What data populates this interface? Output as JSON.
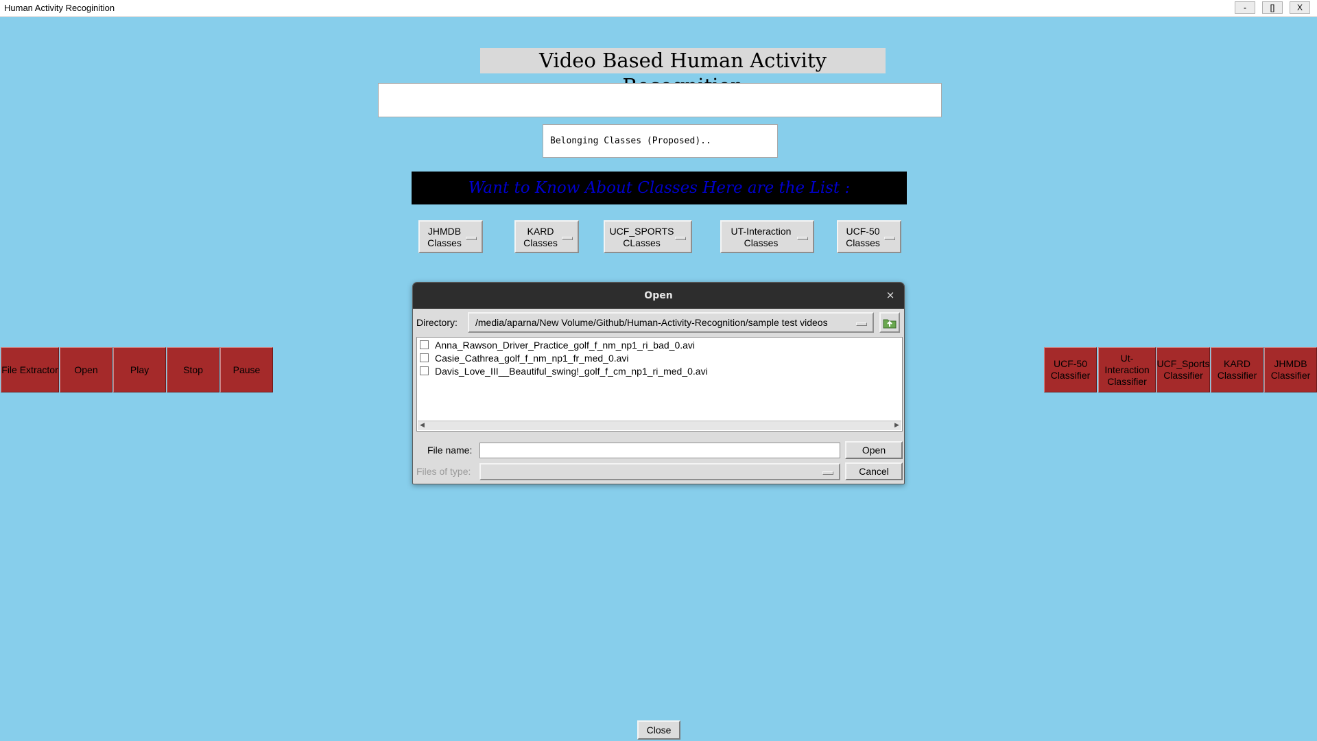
{
  "window": {
    "title": "Human Activity Recoginition",
    "minimize": "-",
    "maximize": "[]",
    "close": "X"
  },
  "main": {
    "heading": "Video Based Human Activity Recognition",
    "result_text": "",
    "classes_text": "Belonging Classes (Proposed)..",
    "banner": "Want to Know About Classes Here are the List :"
  },
  "class_menus": [
    {
      "label": "JHMDB\nClasses"
    },
    {
      "label": "KARD\nClasses"
    },
    {
      "label": "UCF_SPORTS\nCLasses"
    },
    {
      "label": "UT-Interaction\nClasses"
    },
    {
      "label": "UCF-50\nClasses"
    }
  ],
  "left_controls": [
    "File Extractor",
    "Open",
    "Play",
    "Stop",
    "Pause"
  ],
  "classifiers": [
    "UCF-50\nClassifier",
    "Ut-Interaction\nClassifier",
    "UCF_Sports\nClassifier",
    "KARD\nClassifier",
    "JHMDB\nClassifier"
  ],
  "dialog": {
    "title": "Open",
    "close_glyph": "×",
    "directory_label": "Directory:",
    "directory_value": "/media/aparna/New Volume/Github/Human-Activity-Recognition/sample test videos",
    "files": [
      "Anna_Rawson_Driver_Practice_golf_f_nm_np1_ri_bad_0.avi",
      "Casie_Cathrea_golf_f_nm_np1_fr_med_0.avi",
      "Davis_Love_III__Beautiful_swing!_golf_f_cm_np1_ri_med_0.avi"
    ],
    "file_name_label": "File name:",
    "file_name_value": "",
    "files_of_type_label": "Files of type:",
    "open_button": "Open",
    "cancel_button": "Cancel"
  },
  "close_button": "Close",
  "icons": {
    "folder_up": "folder-up-icon",
    "dropdown": "dropdown-indicator-icon"
  },
  "colors": {
    "background": "#87ceeb",
    "control_red": "#a52a2a",
    "banner_bg": "#000000",
    "banner_text": "#0000cd"
  }
}
